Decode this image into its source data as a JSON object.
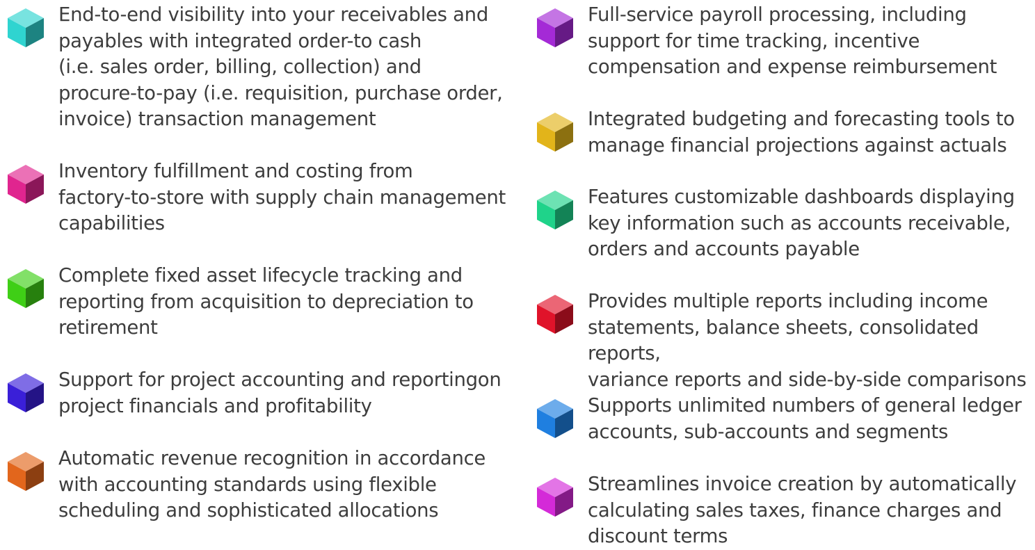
{
  "features": [
    {
      "icon": "teal-cube-icon",
      "color": "#2fd4d0",
      "text": "End-to-end visibility into your receivables and\npayables with integrated order-to cash\n(i.e. sales order, billing, collection) and\nprocure-to-pay (i.e. requisition, purchase order,\ninvoice) transaction management"
    },
    {
      "icon": "pink-cube-icon",
      "color": "#e0258f",
      "text": "Inventory fulfillment and costing from\nfactory-to-store with supply chain management\ncapabilities"
    },
    {
      "icon": "green-cube-icon",
      "color": "#3fcf16",
      "text": "Complete fixed asset lifecycle tracking and\nreporting from acquisition to depreciation to\nretirement"
    },
    {
      "icon": "indigo-cube-icon",
      "color": "#3a1fd8",
      "text": "Support for project accounting and reportingon\nproject financials and profitability"
    },
    {
      "icon": "orange-cube-icon",
      "color": "#e2661c",
      "text": "Automatic revenue recognition in accordance\nwith accounting standards using flexible\nscheduling and sophisticated allocations"
    },
    {
      "icon": "purple-cube-icon",
      "color": "#a42ad6",
      "text": "Full-service payroll processing, including\nsupport for time tracking, incentive\ncompensation and expense reimbursement"
    },
    {
      "icon": "gold-cube-icon",
      "color": "#e2b41a",
      "text": "Integrated budgeting and forecasting tools to\nmanage financial projections against actuals"
    },
    {
      "icon": "mint-cube-icon",
      "color": "#1fd38a",
      "text": "Features customizable dashboards displaying\nkey information such as accounts receivable,\norders and accounts payable"
    },
    {
      "icon": "red-cube-icon",
      "color": "#e0132a",
      "text": "Provides multiple reports including income\nstatements, balance sheets, consolidated reports,\nvariance reports and side-by-side comparisons"
    },
    {
      "icon": "blue-cube-icon",
      "color": "#1f7fe0",
      "text": "Supports unlimited numbers of general ledger\naccounts, sub-accounts and segments"
    },
    {
      "icon": "magenta-cube-icon",
      "color": "#d42ad8",
      "text": "Streamlines invoice creation by automatically\ncalculating sales taxes, finance charges and\ndiscount terms"
    }
  ]
}
